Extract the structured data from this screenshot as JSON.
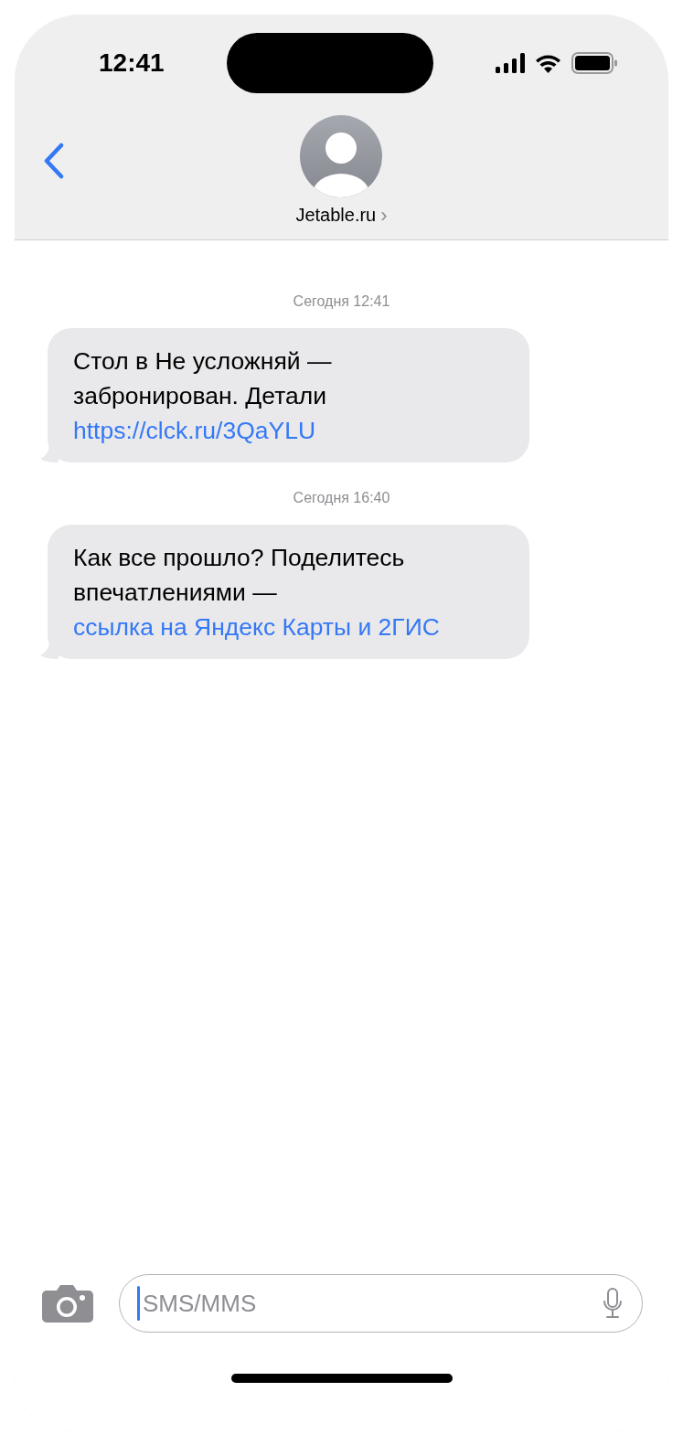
{
  "status_bar": {
    "time": "12:41"
  },
  "header": {
    "contact_name": "Jetable.ru",
    "chevron": "›"
  },
  "messages": [
    {
      "timestamp": "Сегодня 12:41",
      "parts": [
        {
          "kind": "text",
          "text": "Стол в Не усложняй — забронирован. Детали "
        },
        {
          "kind": "link",
          "text": "https://clck.ru/3QaYLU"
        }
      ]
    },
    {
      "timestamp": "Сегодня 16:40",
      "parts": [
        {
          "kind": "text",
          "text": "Как все прошло? Поделитесь впечатлениями — "
        },
        {
          "kind": "link",
          "text": "ссылка на Яндекс Карты и 2ГИС"
        }
      ]
    }
  ],
  "composer": {
    "placeholder": "SMS/MMS"
  }
}
